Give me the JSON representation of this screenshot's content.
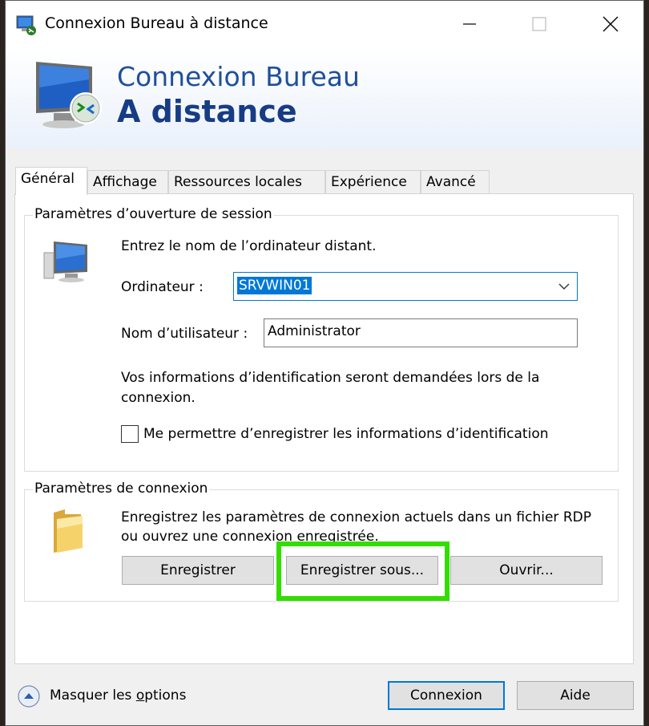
{
  "window": {
    "title": "Connexion Bureau à distance"
  },
  "banner": {
    "line1": "Connexion Bureau",
    "line2": "A distance"
  },
  "tabs": [
    {
      "label": "Général",
      "active": true
    },
    {
      "label": "Affichage",
      "active": false
    },
    {
      "label": "Ressources locales",
      "active": false
    },
    {
      "label": "Expérience",
      "active": false
    },
    {
      "label": "Avancé",
      "active": false
    }
  ],
  "session": {
    "group_title": "Paramètres d’ouverture de session",
    "intro": "Entrez le nom de l’ordinateur distant.",
    "computer_label": "Ordinateur :",
    "computer_value": "SRVWIN01",
    "user_label": "Nom d’utilisateur :",
    "user_value": "Administrator",
    "info": "Vos informations d’identification seront demandées lors de la connexion.",
    "save_creds_label": "Me permettre d’enregistrer les informations d’identification"
  },
  "connection": {
    "group_title": "Paramètres de connexion",
    "description": "Enregistrez les paramètres de connexion actuels dans un fichier RDP ou ouvrez une connexion enregistrée.",
    "save_label": "Enregistrer",
    "save_as_label": "Enregistrer sous...",
    "open_label": "Ouvrir..."
  },
  "footer": {
    "hide_options_prefix": "Masquer les ",
    "hide_options_underlined": "o",
    "hide_options_suffix": "ptions",
    "connect_label": "Connexion",
    "help_label": "Aide"
  },
  "colors": {
    "accent": "#0078d7",
    "highlight": "#33dd00",
    "banner_text": "#1f4f9c"
  }
}
